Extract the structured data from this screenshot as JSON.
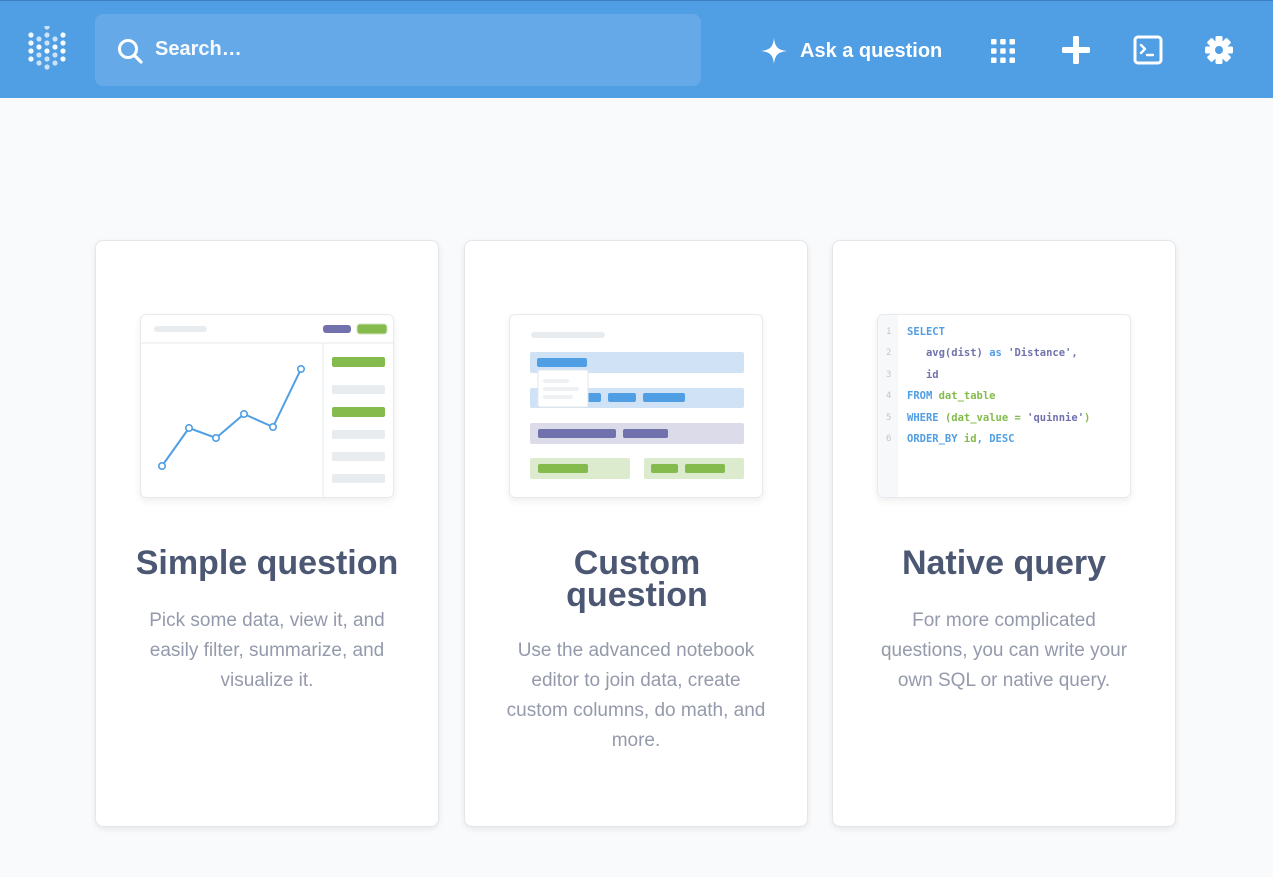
{
  "topbar": {
    "search_placeholder": "Search…",
    "ask_label": "Ask a question",
    "icons": [
      "logo-icon",
      "search-icon",
      "sparkle-icon",
      "grid-icon",
      "plus-icon",
      "terminal-icon",
      "gear-icon"
    ]
  },
  "colors": {
    "brand": "#509ee3",
    "heading": "#4c5773",
    "muted": "#949aab",
    "green": "#84bb4c",
    "purple": "#7172ad"
  },
  "cards": [
    {
      "title": "Simple question",
      "description": "Pick some data, view it, and easily filter, summarize, and visualize it."
    },
    {
      "title": "Custom question",
      "description": "Use the advanced notebook editor to join data, create custom columns, do math, and more."
    },
    {
      "title": "Native query",
      "description": "For more complicated questions, you can write your own SQL or native query."
    }
  ],
  "sql_lines": [
    {
      "n": "1",
      "parts": [
        {
          "t": "SELECT",
          "c": "kw"
        }
      ]
    },
    {
      "n": "2",
      "parts": [
        {
          "t": "   avg(dist) ",
          "c": "fn"
        },
        {
          "t": "as ",
          "c": "kw"
        },
        {
          "t": "'Distance',",
          "c": "fn"
        }
      ]
    },
    {
      "n": "3",
      "parts": [
        {
          "t": "   id",
          "c": "fn"
        }
      ]
    },
    {
      "n": "4",
      "parts": [
        {
          "t": "FROM ",
          "c": "kw"
        },
        {
          "t": "dat_table",
          "c": "st"
        }
      ]
    },
    {
      "n": "5",
      "parts": [
        {
          "t": "WHERE ",
          "c": "kw"
        },
        {
          "t": "(dat_value = ",
          "c": "st"
        },
        {
          "t": "'quinnie'",
          "c": "fn"
        },
        {
          "t": ")",
          "c": "st"
        }
      ]
    },
    {
      "n": "6",
      "parts": [
        {
          "t": "ORDER_BY ",
          "c": "kw"
        },
        {
          "t": "id",
          "c": "st"
        },
        {
          "t": ", DESC",
          "c": "kw"
        }
      ]
    }
  ]
}
